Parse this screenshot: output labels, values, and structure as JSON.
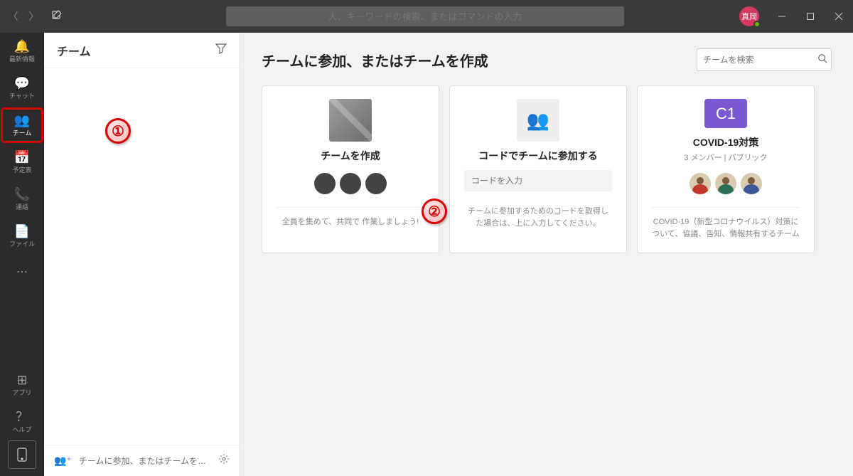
{
  "titlebar": {
    "search_placeholder": "人、キーワードの検索、またはコマンドの入力",
    "avatar_text": "真岡"
  },
  "rail": {
    "items": [
      {
        "icon": "🔔",
        "label": "最新情報"
      },
      {
        "icon": "💬",
        "label": "チャット"
      },
      {
        "icon": "👥",
        "label": "チーム"
      },
      {
        "icon": "📅",
        "label": "予定表"
      },
      {
        "icon": "📞",
        "label": "通話"
      },
      {
        "icon": "📄",
        "label": "ファイル"
      }
    ],
    "apps_label": "アプリ",
    "help_label": "ヘルプ"
  },
  "listpane": {
    "title": "チーム",
    "footer_text": "チームに参加、またはチームを…"
  },
  "main": {
    "heading": "チームに参加、またはチームを作成",
    "search_placeholder": "チームを検索",
    "create_card": {
      "title": "チームを作成",
      "desc": "全員を集めて、共同で 作業しましょう!"
    },
    "join_code_card": {
      "title": "コードでチームに参加する",
      "input_placeholder": "コードを入力",
      "hint": "チームに参加するためのコードを取得した場合は、上に入力してください。"
    },
    "existing_card": {
      "badge": "C1",
      "title": "COVID-19対策",
      "subtitle": "3 メンバー | パブリック",
      "desc": "COVID-19（新型コロナウイルス）対策について、協議、告知、情報共有するチーム"
    }
  },
  "annotations": {
    "one": "①",
    "two": "②"
  }
}
